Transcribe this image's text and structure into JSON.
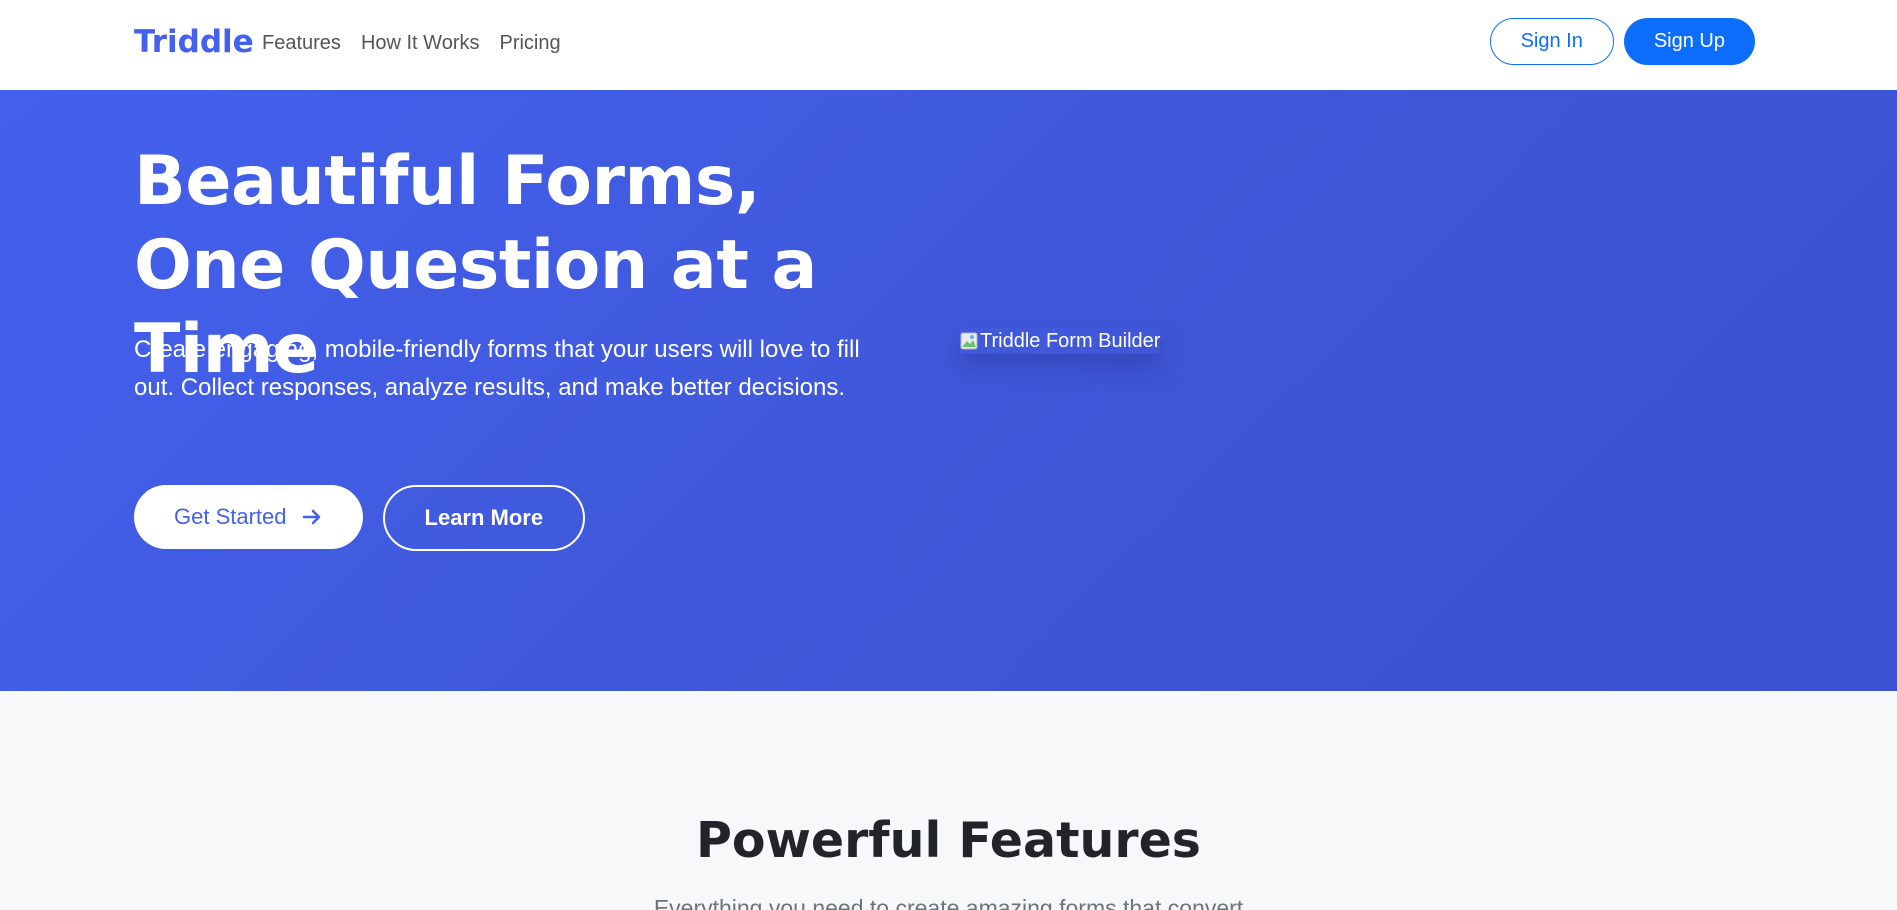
{
  "navbar": {
    "brand": "Triddle",
    "links": [
      "Features",
      "How It Works",
      "Pricing"
    ],
    "sign_in": "Sign In",
    "sign_up": "Sign Up"
  },
  "hero": {
    "title": "Beautiful Forms, One Question at a Time",
    "subtitle": "Create engaging, mobile-friendly forms that your users will love to fill out. Collect responses, analyze results, and make better decisions.",
    "primary_button": "Get Started",
    "secondary_button": "Learn More",
    "image_alt": "Triddle Form Builder"
  },
  "features": {
    "title": "Powerful Features",
    "subtitle": "Everything you need to create amazing forms that convert"
  },
  "colors": {
    "brand": "#4361ee",
    "hero_bg": "#4361ee",
    "nav_button": "#0d6efd",
    "page_bg": "#f7f8fa"
  },
  "icons": {
    "get_started": "arrow-right-icon",
    "hero_image": "broken-image-icon"
  }
}
